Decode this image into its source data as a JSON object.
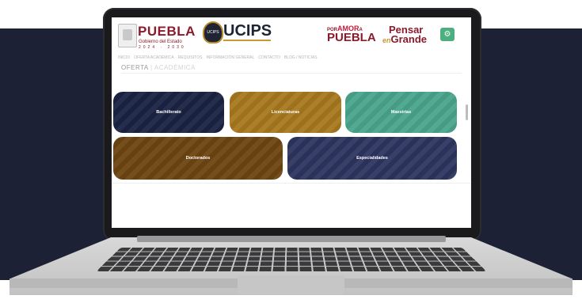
{
  "header": {
    "puebla": "PUEBLA",
    "puebla_sub": "Gobierno del Estado",
    "puebla_years": "2024 · 2030",
    "ucips_badge": "UCIPS",
    "ucips": "UCIPS",
    "amor_line1": "POR",
    "amor_line1b": "AMOR",
    "amor_line1c": "A",
    "amor_line2": "PUEBLA",
    "pensar": "Pensar",
    "en": "en",
    "grande": "Grande",
    "corner_icon": "⚙"
  },
  "nav": {
    "items": [
      "INICIO",
      "OFERTA ACADÉMICA",
      "REQUISITOS",
      "INFORMACIÓN GENERAL",
      "CONTACTO",
      "BLOG / NOTICIAS"
    ]
  },
  "breadcrumb": {
    "part1": "OFERTA",
    "part2": "ACADÉMICA"
  },
  "cards": [
    {
      "label": "Bachillerato",
      "color": "#1a2343"
    },
    {
      "label": "Licenciaturas",
      "color": "#a8781f"
    },
    {
      "label": "Maestrías",
      "color": "#4aa58c"
    },
    {
      "label": "Doctorados",
      "color": "#6e4512"
    },
    {
      "label": "Especialidades",
      "color": "#2d3560"
    }
  ],
  "colors": {
    "brand": "#8b1a2b",
    "accent_gold": "#c99a33",
    "backdrop": "#1c2135"
  }
}
